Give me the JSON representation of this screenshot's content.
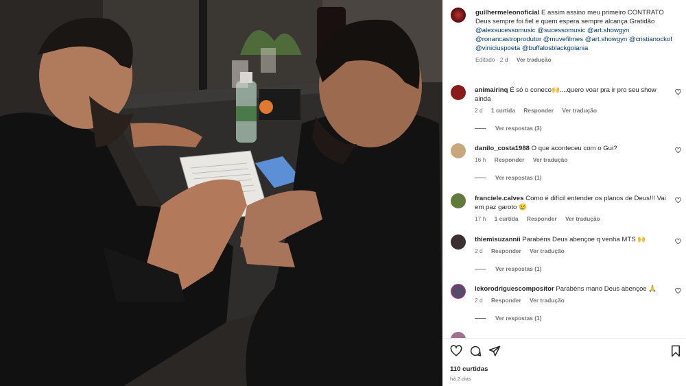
{
  "post": {
    "username": "guilhermeleonoficial",
    "caption": "E assim assino meu primeiro CONTRATO Deus sempre foi fiel e quem espera sempre alcança Gratidão",
    "mentions_line1": "@alexsucessomusic @sucessomusic",
    "mentions_line2": "@art.showgyn @ronancastroprodutor @muvefilmes",
    "mentions_line3": "@art.showgyn @cristianockof @viniciuspoeta",
    "mentions_line4": "@buffalosblackgoiania",
    "edited": "Editado · 2 d",
    "see_translation": "Ver tradução"
  },
  "comments": [
    {
      "username": "animairinq",
      "text": "É só o coneco🙌....quero voar pra ir pro seu show ainda",
      "time": "2 d",
      "likes": "1 curtida",
      "reply": "Responder",
      "translate": "Ver tradução",
      "view_replies": "Ver respostas (3)",
      "avatar_color": "#8b1a1a"
    },
    {
      "username": "danilo_costa1988",
      "text": "O que aconteceu com o Gui?",
      "time": "16 h",
      "likes": "",
      "reply": "Responder",
      "translate": "Ver tradução",
      "view_replies": "Ver respostas (1)",
      "avatar_color": "#c9a77c"
    },
    {
      "username": "franciele.calves",
      "text": "Como é difícil entender os planos de Deus!!! Vai em paz garoto 😢",
      "time": "17 h",
      "likes": "1 curtida",
      "reply": "Responder",
      "translate": "Ver tradução",
      "view_replies": "",
      "avatar_color": "#5f7a3a"
    },
    {
      "username": "thiemisuzannii",
      "text": "Parabéns Deus abençoe q venha MTS 🙌",
      "time": "2 d",
      "likes": "",
      "reply": "Responder",
      "translate": "Ver tradução",
      "view_replies": "Ver respostas (1)",
      "avatar_color": "#3a3030"
    },
    {
      "username": "lekorodriguescompositor",
      "text": "Parabéns mano Deus abençoe 🙏",
      "time": "2 d",
      "likes": "",
      "reply": "Responder",
      "translate": "Ver tradução",
      "view_replies": "Ver respostas (1)",
      "avatar_color": "#5a4a6a"
    }
  ],
  "footer": {
    "likes": "110 curtidas",
    "ago": "há 2 dias"
  },
  "icons": {
    "like": "heart-icon",
    "comment": "comment-icon",
    "share": "share-icon",
    "save": "bookmark-icon"
  },
  "colors": {
    "link": "#00376b",
    "muted": "#737373",
    "text": "#262626"
  }
}
